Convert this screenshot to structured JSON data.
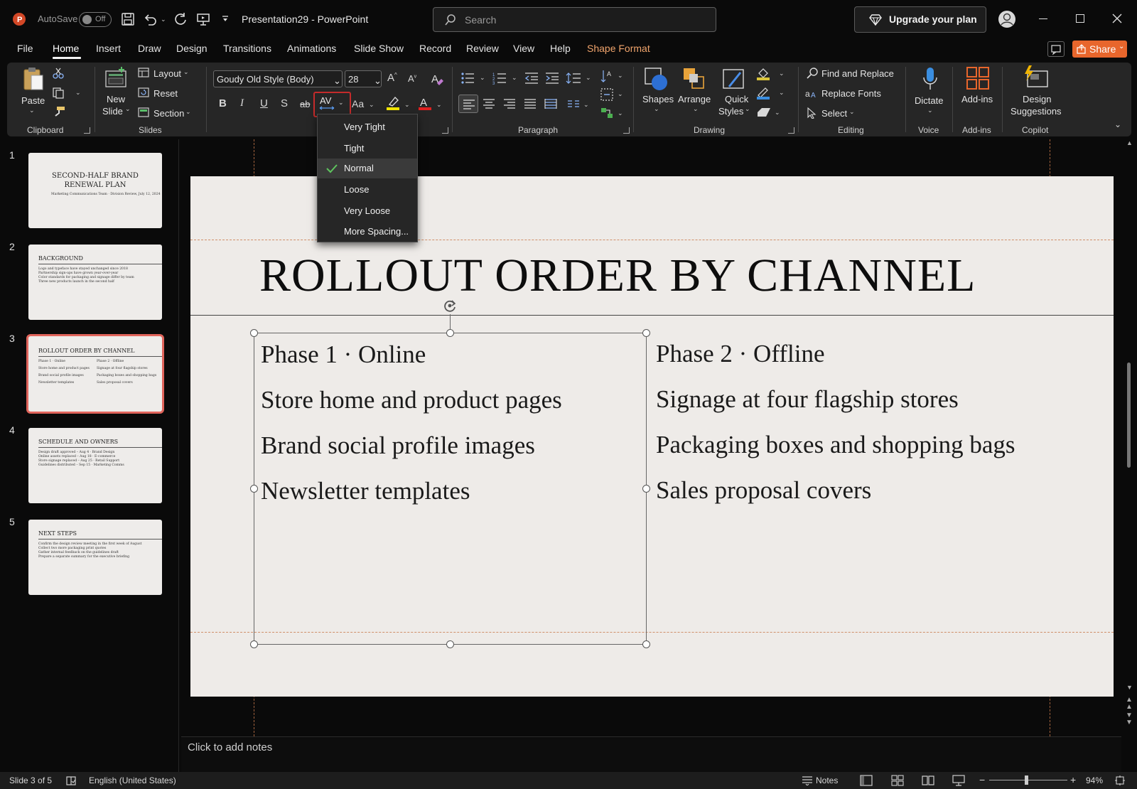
{
  "titlebar": {
    "autosave_label": "AutoSave",
    "autosave_state": "Off",
    "document_title": "Presentation29 - PowerPoint",
    "search_placeholder": "Search",
    "upgrade_label": "Upgrade your plan"
  },
  "menu_tabs": [
    "File",
    "Home",
    "Insert",
    "Draw",
    "Design",
    "Transitions",
    "Animations",
    "Slide Show",
    "Record",
    "Review",
    "View",
    "Help",
    "Shape Format"
  ],
  "active_tab": "Home",
  "share_label": "Share",
  "ribbon": {
    "clipboard": {
      "paste": "Paste",
      "label": "Clipboard"
    },
    "slides": {
      "new_slide_line1": "New",
      "new_slide_line2": "Slide",
      "layout": "Layout",
      "reset": "Reset",
      "section": "Section",
      "label": "Slides"
    },
    "font": {
      "font_name": "Goudy Old Style (Body)",
      "font_size": "28",
      "char_spacing_icon": "AV",
      "change_case": "Aa"
    },
    "paragraph": {
      "label": "Paragraph"
    },
    "drawing": {
      "shapes": "Shapes",
      "arrange": "Arrange",
      "quick_styles_line1": "Quick",
      "quick_styles_line2": "Styles",
      "label": "Drawing"
    },
    "editing": {
      "find_replace": "Find and Replace",
      "replace_fonts": "Replace Fonts",
      "select": "Select",
      "label": "Editing"
    },
    "voice": {
      "dictate": "Dictate",
      "label": "Voice"
    },
    "addins": {
      "addins": "Add-ins",
      "label": "Add-ins"
    },
    "copilot": {
      "design_line1": "Design",
      "design_line2": "Suggestions",
      "label": "Copilot"
    }
  },
  "spacing_menu": {
    "items": [
      "Very Tight",
      "Tight",
      "Normal",
      "Loose",
      "Very Loose",
      "More Spacing..."
    ],
    "selected": "Normal"
  },
  "thumbnails": [
    {
      "num": "1",
      "title_line1": "SECOND-HALF BRAND",
      "title_line2": "RENEWAL PLAN",
      "subtitle": "Marketing Communications Team · Division Review, July 12, 2024"
    },
    {
      "num": "2",
      "title": "BACKGROUND",
      "lines": [
        "Logo and typeface have stayed unchanged since 2018",
        "Partnership sign-ups have grown year-over-year",
        "Color standards for packaging and signage differ by team",
        "Three new products launch in the second half"
      ]
    },
    {
      "num": "3",
      "title": "ROLLOUT ORDER BY CHANNEL",
      "left": [
        "Phase 1 · Online",
        "Store home and product pages",
        "Brand social profile images",
        "Newsletter templates"
      ],
      "right": [
        "Phase 2 · Offline",
        "Signage at four flagship stores",
        "Packaging boxes and shopping bags",
        "Sales proposal covers"
      ]
    },
    {
      "num": "4",
      "title": "SCHEDULE AND OWNERS",
      "lines": [
        "Design draft approved – Aug 4 · Brand Design",
        "Online assets replaced – Aug 18 · E-commerce",
        "Store signage replaced – Aug 25 · Retail Support",
        "Guidelines distributed – Sep 15 · Marketing Comms"
      ]
    },
    {
      "num": "5",
      "title": "NEXT STEPS",
      "lines": [
        "Confirm the design review meeting in the first week of August",
        "Collect two more packaging print quotes",
        "Gather internal feedback on the guidelines draft",
        "Prepare a separate summary for the executive briefing"
      ]
    }
  ],
  "slide": {
    "title": "ROLLOUT ORDER BY CHANNEL",
    "left_column": [
      "Phase 1 · Online",
      "Store home and product pages",
      "Brand social profile images",
      "Newsletter templates"
    ],
    "right_column": [
      "Phase 2 · Offline",
      "Signage at four flagship stores",
      "Packaging boxes and shopping bags",
      "Sales proposal covers"
    ]
  },
  "notes_placeholder": "Click to add notes",
  "status": {
    "slide_info": "Slide 3 of 5",
    "language": "English (United States)",
    "notes_label": "Notes",
    "zoom": "94%"
  },
  "colors": {
    "accent_orange": "#e8662c",
    "shape_format_tab": "#f0a46c",
    "active_thumb_border": "#e0645b",
    "dropdown_highlight": "#c42b2b"
  }
}
